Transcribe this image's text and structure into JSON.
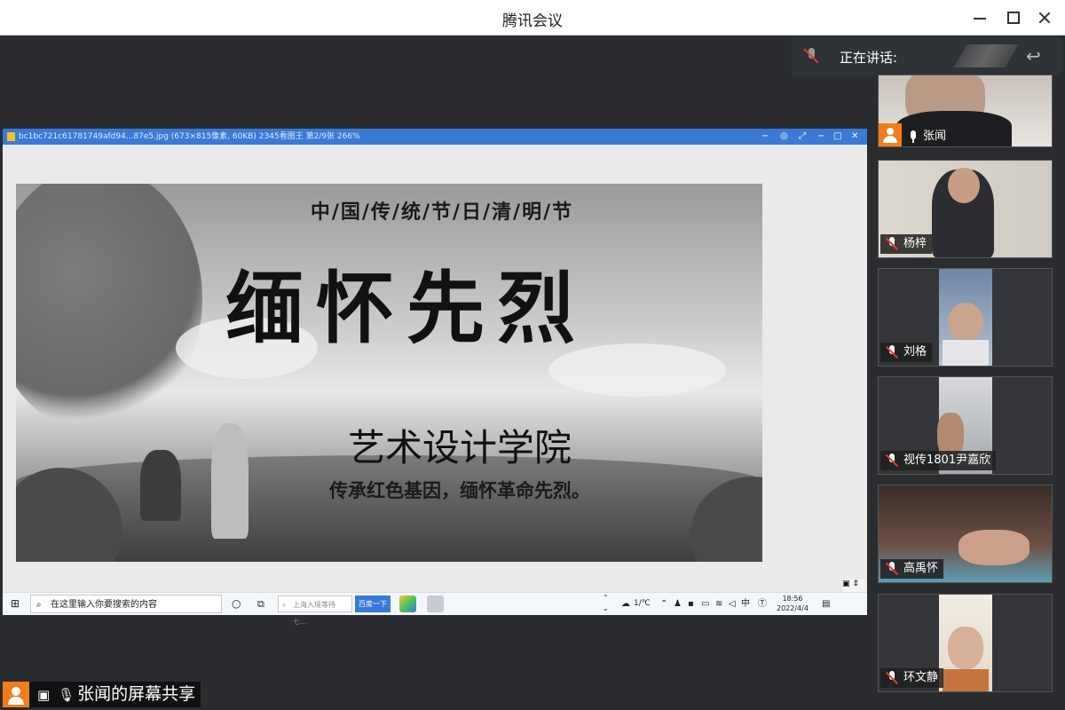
{
  "window": {
    "title": "腾讯会议"
  },
  "speaking": {
    "label": "正在讲话:"
  },
  "viewer": {
    "file_title": "bc1bc721c61781749afd94...87e5.jpg   (673×815像素, 60KB)   2345看图王   第2/9张 266%",
    "poster": {
      "subtitle": "中/国/传/统/节/日/清/明/节",
      "title": "缅怀先烈",
      "college": "艺术设计学院",
      "slogan": "传承红色基因，缅怀革命先烈。"
    }
  },
  "taskbar": {
    "search_placeholder": "在这里输入你要搜索的内容",
    "browser_search_placeholder": "上海入境等待 七...",
    "browser_search_button": "百度一下",
    "weather": "1/℃",
    "ime": "中",
    "time": "18:56",
    "date": "2022/4/4"
  },
  "share_label": "张闻的屏幕共享",
  "participants": [
    {
      "name": "张闻",
      "muted": false
    },
    {
      "name": "杨梓",
      "muted": true
    },
    {
      "name": "刘格",
      "muted": true
    },
    {
      "name": "视传1801尹嘉欣",
      "muted": true
    },
    {
      "name": "高禹怀",
      "muted": true
    },
    {
      "name": "环文静",
      "muted": true
    }
  ],
  "colors": {
    "accent": "#f07e1b",
    "viewer_bar": "#3a79d6",
    "muted": "#e23b3b"
  }
}
